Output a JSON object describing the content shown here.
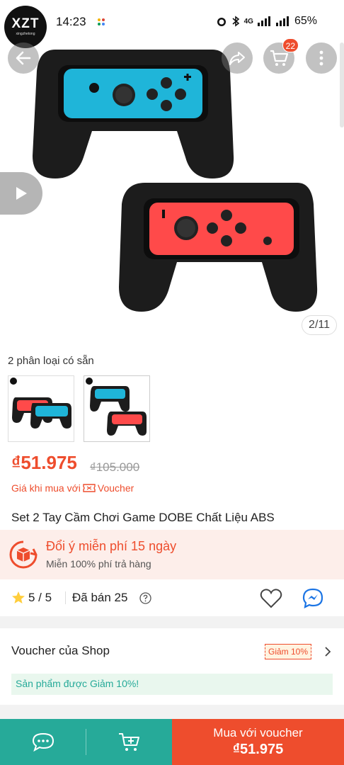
{
  "status": {
    "time": "14:23",
    "network": "4G",
    "battery": "65%"
  },
  "brand": {
    "logo_text": "XZT",
    "logo_sub": "xingzhetong"
  },
  "header": {
    "cart_count": "22"
  },
  "gallery": {
    "counter": "2/11"
  },
  "variants": {
    "title": "2 phân loại có sẵn"
  },
  "price": {
    "current": "₫51.975",
    "original": "₫105.000",
    "voucher_prefix": "Giá khi mua với",
    "voucher_word": "Voucher"
  },
  "product": {
    "title": "Set 2 Tay Cầm Chơi Game DOBE Chất Liệu ABS"
  },
  "return_policy": {
    "title": "Đổi ý miễn phí 15 ngày",
    "subtitle": "Miễn 100% phí trả hàng"
  },
  "rating": {
    "score": "5 / 5",
    "sold": "Đã bán 25"
  },
  "shop_voucher": {
    "label": "Voucher của Shop",
    "tag": "Giảm 10%",
    "note": "Sản phẩm được Giảm 10%!"
  },
  "bottom": {
    "buy_label": "Mua với voucher",
    "buy_price": "₫51.975"
  },
  "colors": {
    "accent": "#ee4d2d",
    "teal": "#26aa99",
    "joycon_blue": "#1fb5d9",
    "joycon_red": "#ff4a4a"
  }
}
